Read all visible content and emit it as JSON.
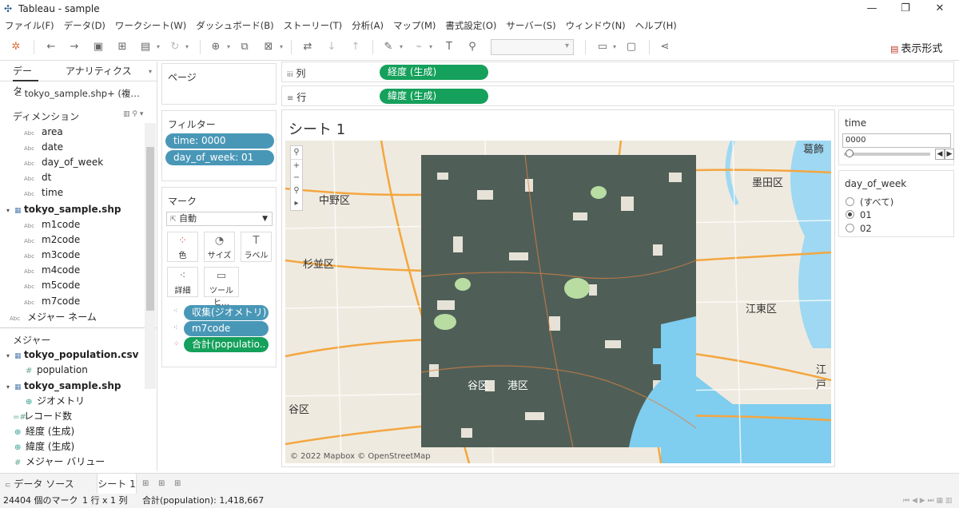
{
  "window": {
    "title": "Tableau - sample",
    "app_icon": "tableau-logo-icon"
  },
  "menu": [
    "ファイル(F)",
    "データ(D)",
    "ワークシート(W)",
    "ダッシュボード(B)",
    "ストーリー(T)",
    "分析(A)",
    "マップ(M)",
    "書式設定(O)",
    "サーバー(S)",
    "ウィンドウ(N)",
    "ヘルプ(H)"
  ],
  "toolbar": {
    "show_me": "表示形式"
  },
  "data_pane": {
    "tabs": [
      "データ",
      "アナリティクス"
    ],
    "datasource": "tokyo_sample.shp+ (複…",
    "dimensions_label": "ディメンション",
    "dimensions": [
      "area",
      "date",
      "day_of_week",
      "dt",
      "time"
    ],
    "table1": "tokyo_sample.shp",
    "table1_fields": [
      "m1code",
      "m2code",
      "m3code",
      "m4code",
      "m5code",
      "m7code"
    ],
    "measure_names": "メジャー ネーム",
    "measures_label": "メジャー",
    "table2": "tokyo_population.csv",
    "table2_fields": [
      "population"
    ],
    "table3": "tokyo_sample.shp",
    "table3_fields": [
      "ジオメトリ"
    ],
    "other_measures": [
      "レコード数",
      "経度 (生成)",
      "緯度 (生成)",
      "メジャー バリュー"
    ]
  },
  "shelves": {
    "pages_label": "ページ",
    "filters_label": "フィルター",
    "filters": [
      "time: 0000",
      "day_of_week: 01"
    ],
    "marks_label": "マーク",
    "mark_type": "自動",
    "mark_buttons": [
      "色",
      "サイズ",
      "ラベル",
      "詳細",
      "ツールヒ…"
    ],
    "mark_pills": [
      "収集(ジオメトリ)",
      "m7code",
      "合計(populatio.."
    ],
    "columns_label": "列",
    "columns_pill": "経度 (生成)",
    "rows_label": "行",
    "rows_pill": "緯度 (生成)"
  },
  "view": {
    "title": "シート 1",
    "copyright": "© 2022 Mapbox © OpenStreetMap",
    "map_labels": [
      "中野区",
      "杉並区",
      "墨田区",
      "江東区",
      "葛飾",
      "谷区",
      "港区",
      "谷区",
      "江戸"
    ]
  },
  "time_filter": {
    "title": "time",
    "value": "0000"
  },
  "dow_filter": {
    "title": "day_of_week",
    "options": [
      "(すべて)",
      "01",
      "02"
    ],
    "selected": "01"
  },
  "sheets": {
    "datasource_tab": "データ ソース",
    "sheet_tab": "シート 1"
  },
  "status": {
    "marks": "24404 個のマーク",
    "rowcol": "1 行 x 1 列",
    "sum": "合計(population): 1,418,667"
  }
}
